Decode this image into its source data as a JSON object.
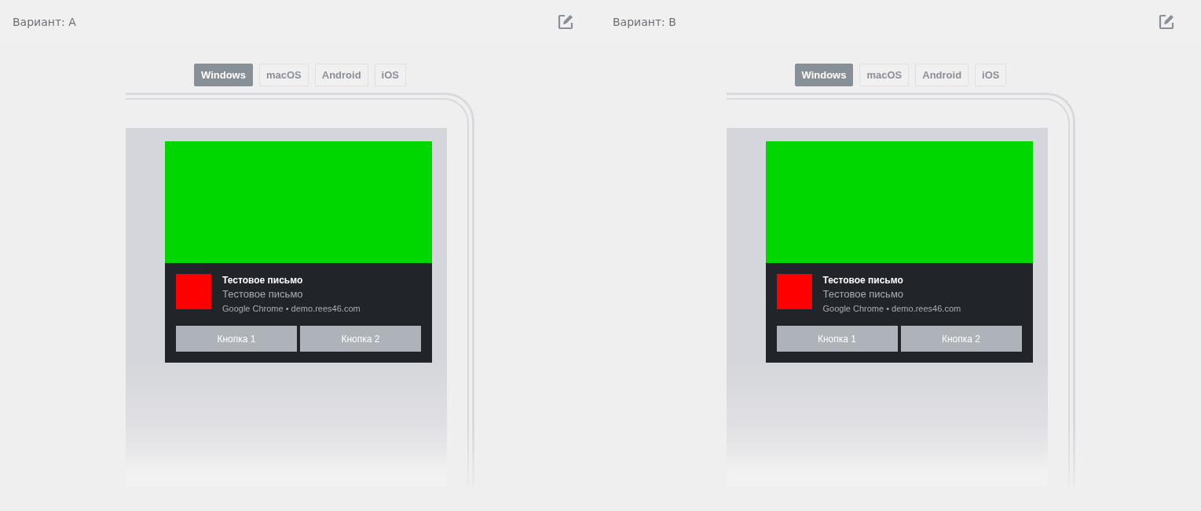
{
  "variants": [
    {
      "label": "Вариант: A",
      "tabs": [
        {
          "label": "Windows",
          "selected": true
        },
        {
          "label": "macOS",
          "selected": false
        },
        {
          "label": "Android",
          "selected": false
        },
        {
          "label": "iOS",
          "selected": false
        }
      ],
      "notification": {
        "title": "Тестовое письмо",
        "body": "Тестовое письмо",
        "source": "Google Chrome • demo.rees46.com",
        "buttons": [
          "Кнопка 1",
          "Кнопка 2"
        ]
      }
    },
    {
      "label": "Вариант: B",
      "tabs": [
        {
          "label": "Windows",
          "selected": true
        },
        {
          "label": "macOS",
          "selected": false
        },
        {
          "label": "Android",
          "selected": false
        },
        {
          "label": "iOS",
          "selected": false
        }
      ],
      "notification": {
        "title": "Тестовое письмо",
        "body": "Тестовое письмо",
        "source": "Google Chrome • demo.rees46.com",
        "buttons": [
          "Кнопка 1",
          "Кнопка 2"
        ]
      }
    }
  ]
}
